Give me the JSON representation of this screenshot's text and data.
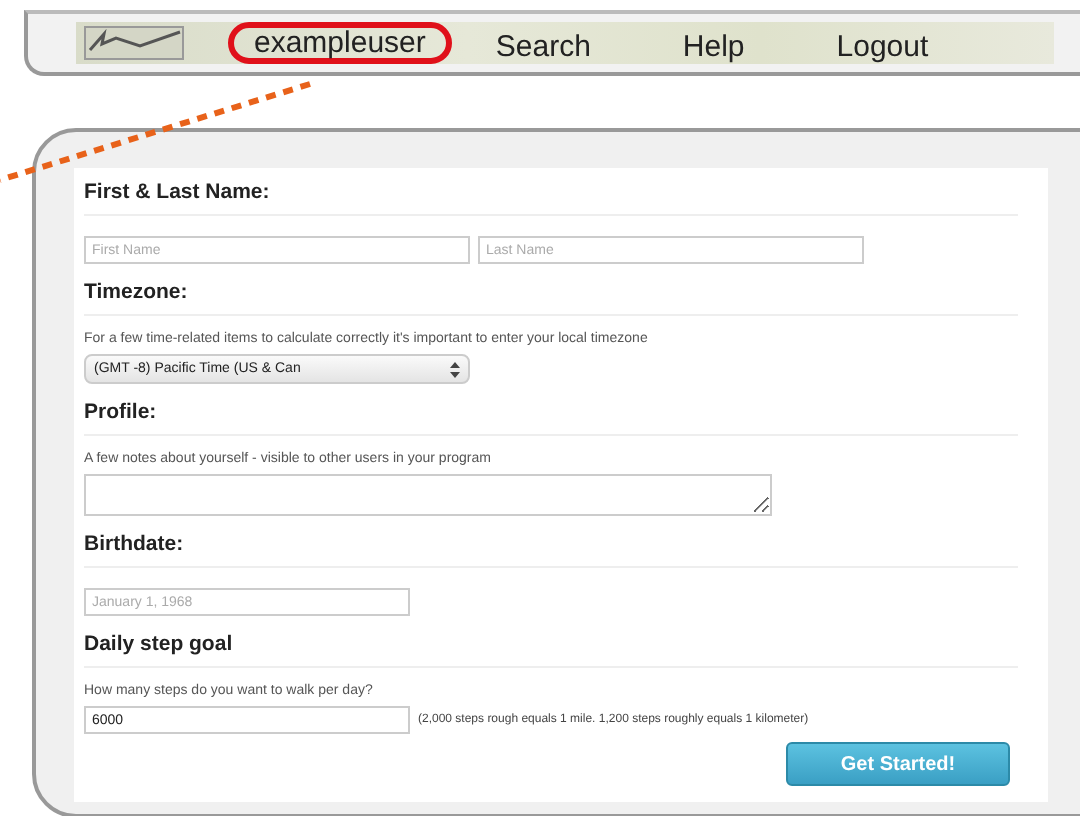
{
  "nav": {
    "items": [
      {
        "label": "exampleuser",
        "circled": true
      },
      {
        "label": "Search",
        "circled": false
      },
      {
        "label": "Help",
        "circled": false
      },
      {
        "label": "Logout",
        "circled": false
      }
    ]
  },
  "form": {
    "sections": [
      {
        "heading": "First & Last Name:",
        "controls": [
          {
            "kind": "input",
            "placeholder": "First Name"
          },
          {
            "kind": "input",
            "placeholder": "Last Name"
          }
        ]
      },
      {
        "heading": "Timezone:",
        "description": "For a few time-related items to calculate correctly it's important to enter your local timezone",
        "controls": [
          {
            "kind": "select",
            "value": "(GMT -8) Pacific Time (US & Can"
          }
        ]
      },
      {
        "heading": "Profile:",
        "description": "A few notes about yourself - visible to other users in your program",
        "controls": [
          {
            "kind": "textarea"
          }
        ]
      },
      {
        "heading": "Birthdate:",
        "controls": [
          {
            "kind": "short_input",
            "placeholder": "January 1, 1968"
          }
        ]
      },
      {
        "heading": "Daily step goal",
        "description": "How many steps do you want to walk per day?",
        "controls": [
          {
            "kind": "short_input",
            "value": "6000",
            "note": "(2,000 steps rough equals 1 mile. 1,200 steps roughly equals 1 kilometer)"
          }
        ]
      }
    ],
    "button": "Get Started!"
  }
}
